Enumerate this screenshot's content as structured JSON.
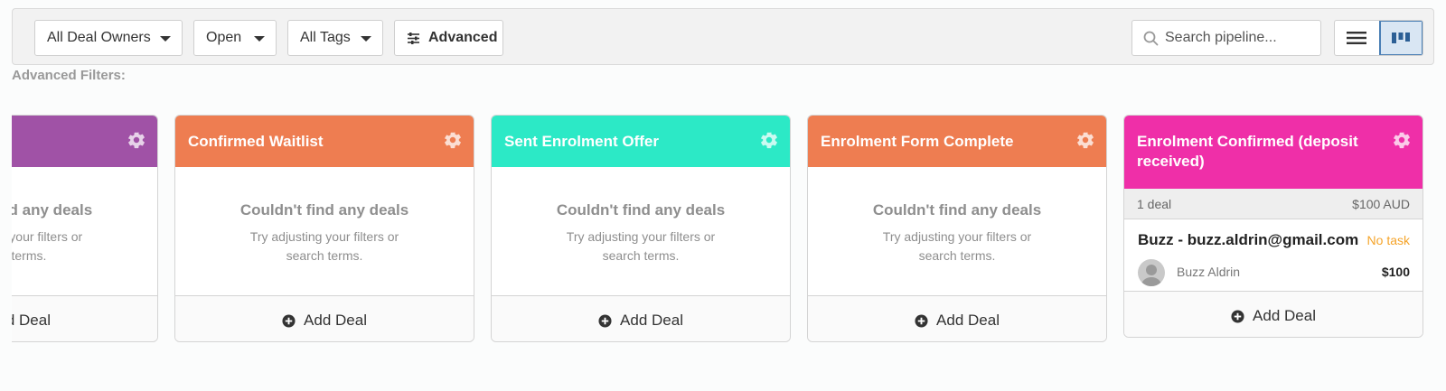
{
  "toolbar": {
    "owners_filter": "All Deal Owners",
    "status_filter": "Open",
    "tags_filter": "All Tags",
    "advanced_label": "Advanced",
    "search_placeholder": "Search pipeline..."
  },
  "advanced_filters_label": "Advanced Filters:",
  "stages": [
    {
      "title": "",
      "color": "#a052a6",
      "empty_title": "Couldn't find any deals",
      "empty_hint": "Try adjusting your filters or search terms.",
      "add_label": "Add Deal"
    },
    {
      "title": "Confirmed Waitlist",
      "color": "#ee7d51",
      "empty_title": "Couldn't find any deals",
      "empty_hint": "Try adjusting your filters or search terms.",
      "add_label": "Add Deal"
    },
    {
      "title": "Sent Enrolment Offer",
      "color": "#2ce9c6",
      "empty_title": "Couldn't find any deals",
      "empty_hint": "Try adjusting your filters or search terms.",
      "add_label": "Add Deal"
    },
    {
      "title": "Enrolment Form Complete",
      "color": "#ee7d51",
      "empty_title": "Couldn't find any deals",
      "empty_hint": "Try adjusting your filters or search terms.",
      "add_label": "Add Deal"
    },
    {
      "title": "Enrolment Confirmed (deposit received)",
      "color": "#ef2fa8",
      "deal_count": "1 deal",
      "total": "$100 AUD",
      "add_label": "Add Deal",
      "deals": [
        {
          "title": "Buzz - buzz.aldrin@gmail.com",
          "task": "No task",
          "owner": "Buzz Aldrin",
          "value": "$100"
        }
      ]
    }
  ]
}
